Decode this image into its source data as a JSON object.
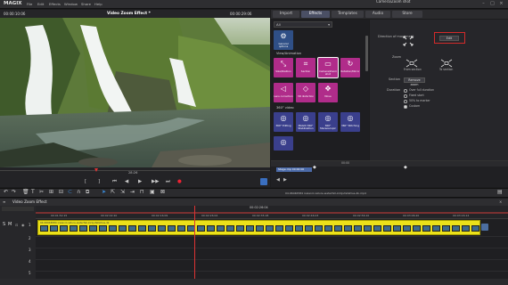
{
  "app": {
    "logo": "MAGIX",
    "colors": {
      "accent": "#4a4f64",
      "effect_tile": "#b02c8a",
      "clip": "#ece11a",
      "highlight_box": "#d32a2a"
    }
  },
  "menu": [
    "File",
    "Edit",
    "Effects",
    "Window",
    "Share",
    "Help"
  ],
  "preview": {
    "time_left": "00:00:10:06",
    "title": "Video Zoom Effect *",
    "time_right": "00:00:29:06",
    "position_label": "28:26"
  },
  "tabs": [
    {
      "label": "Import",
      "active": false
    },
    {
      "label": "Effects",
      "active": true
    },
    {
      "label": "Templates",
      "active": false
    },
    {
      "label": "Audio",
      "active": false
    },
    {
      "label": "Store",
      "active": false
    }
  ],
  "effects": {
    "dropdown_value": "All",
    "general_options_label": "General options",
    "section_animation": "View/Animation",
    "animation_items": [
      "Size/Position",
      "Section",
      "Camera/Zoom shot",
      "Rotation/Mirror",
      "Lens correction",
      "3D distortion",
      "Move"
    ],
    "section_360": "360° video",
    "items_360": [
      "360° Editing",
      "MAGIX 360° Stabilization",
      "360° Stereoscopic",
      "360° Stitching"
    ]
  },
  "params": {
    "title": "Camera/Zoom shot",
    "direction_label": "Direction of movement",
    "edit_button": "Edit",
    "zoom_label": "Zoom",
    "from_section_label": "From section",
    "to_section_label": "To section",
    "section_label": "Section",
    "remove_zoom_button": "Remove zoom",
    "duration_label": "Duration",
    "duration_options": [
      {
        "label": "Over full duration",
        "selected": false
      },
      {
        "label": "Fixed start",
        "selected": false
      },
      {
        "label": "50% to marker",
        "selected": false
      },
      {
        "label": "Custom",
        "selected": true
      }
    ]
  },
  "fx_timeline": {
    "keyframe_label": "Stage clip 00:00:00",
    "time": "00:00"
  },
  "timeline": {
    "project_title": "Video Zoom Effect",
    "ruler_top": "00:02:26:04",
    "ruler_ticks": [
      "00:01:52:15",
      "00:02:02:20",
      "00:02:16:09",
      "00:02:26:04",
      "00:02:35:18",
      "00:02:46:03",
      "00:02:56:10",
      "00:03:06:20",
      "00:03:16:14"
    ],
    "clip_name": "04.06046584 iceland-nature-waterfall-kirkjufellsfoss-4k",
    "file_path": "04.06046584 iceland-nature-waterfall-kirkjufellsfoss-4k.mp4",
    "track_numbers": [
      "1",
      "2",
      "3",
      "4",
      "5"
    ]
  }
}
